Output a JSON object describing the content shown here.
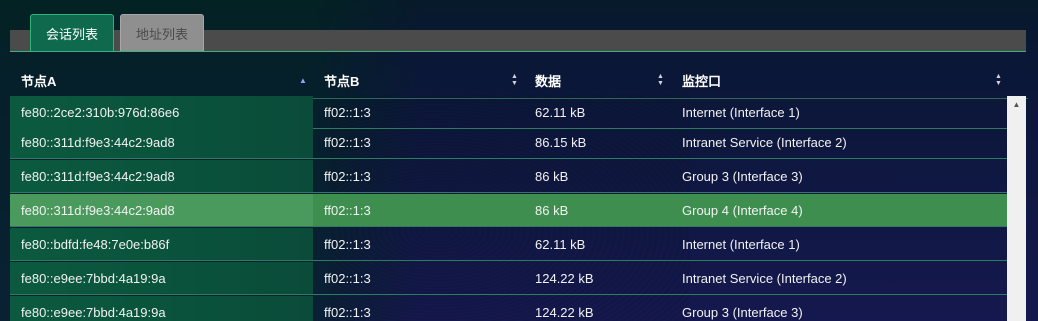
{
  "tabs": [
    {
      "label": "会话列表",
      "active": true
    },
    {
      "label": "地址列表",
      "active": false
    }
  ],
  "table": {
    "columns": [
      {
        "label": "节点A",
        "sort": "asc"
      },
      {
        "label": "节点B",
        "sort": "none"
      },
      {
        "label": "数据",
        "sort": "none"
      },
      {
        "label": "监控口",
        "sort": "none"
      }
    ],
    "rows": [
      {
        "node_a": "fe80::2ce2:310b:976d:86e6",
        "node_b": "ff02::1:3",
        "data": "62.11 kB",
        "monitor": "Internet (Interface 1)",
        "selected": false
      },
      {
        "node_a": "fe80::311d:f9e3:44c2:9ad8",
        "node_b": "ff02::1:3",
        "data": "86.15 kB",
        "monitor": "Intranet Service (Interface 2)",
        "selected": false
      },
      {
        "node_a": "fe80::311d:f9e3:44c2:9ad8",
        "node_b": "ff02::1:3",
        "data": "86 kB",
        "monitor": "Group 3 (Interface 3)",
        "selected": false
      },
      {
        "node_a": "fe80::311d:f9e3:44c2:9ad8",
        "node_b": "ff02::1:3",
        "data": "86 kB",
        "monitor": "Group 4 (Interface 4)",
        "selected": true
      },
      {
        "node_a": "fe80::bdfd:fe48:7e0e:b86f",
        "node_b": "ff02::1:3",
        "data": "62.11 kB",
        "monitor": "Internet (Interface 1)",
        "selected": false
      },
      {
        "node_a": "fe80::e9ee:7bbd:4a19:9a",
        "node_b": "ff02::1:3",
        "data": "124.22 kB",
        "monitor": "Intranet Service (Interface 2)",
        "selected": false
      },
      {
        "node_a": "fe80::e9ee:7bbd:4a19:9a",
        "node_b": "ff02::1:3",
        "data": "124.22 kB",
        "monitor": "Group 3 (Interface 3)",
        "selected": false
      }
    ]
  },
  "icons": {
    "sort_asc": "sort-ascending-icon",
    "sort_both": "sort-both-icon",
    "scroll_up": "scroll-up-arrow-icon"
  },
  "colors": {
    "tab_active": "#0f6a4d",
    "tab_inactive": "#8f8f8f",
    "selected_row": "#3e8f4f",
    "row_border": "#2f7a60"
  }
}
